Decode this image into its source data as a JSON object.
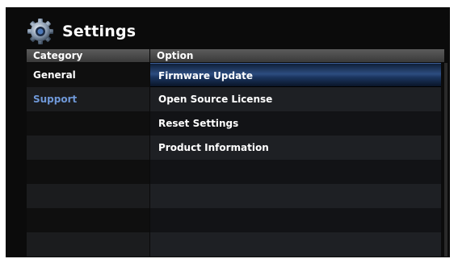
{
  "header": {
    "title": "Settings",
    "icon": "gear-icon"
  },
  "columns": {
    "category": "Category",
    "option": "Option"
  },
  "categories": [
    {
      "label": "General",
      "selected": false
    },
    {
      "label": "Support",
      "selected": true
    },
    {
      "label": ""
    },
    {
      "label": ""
    },
    {
      "label": ""
    },
    {
      "label": ""
    },
    {
      "label": ""
    },
    {
      "label": ""
    }
  ],
  "options": [
    {
      "label": "Firmware Update",
      "highlighted": true
    },
    {
      "label": "Open Source License"
    },
    {
      "label": "Reset Settings"
    },
    {
      "label": "Product Information"
    },
    {
      "label": ""
    },
    {
      "label": ""
    },
    {
      "label": ""
    },
    {
      "label": ""
    }
  ],
  "colors": {
    "accent": "#6f98d8",
    "highlight": "#2d4d80",
    "background": "#0b0b0b"
  }
}
